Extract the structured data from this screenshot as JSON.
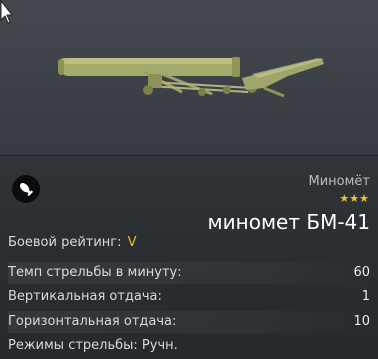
{
  "weapon": {
    "category": "Миномёт",
    "stars": "★★★",
    "name": "миномет БМ-41",
    "icon": "mortar-shell-icon"
  },
  "battle_rating": {
    "label": "Боевой рейтинг:",
    "value": "V"
  },
  "stats": [
    {
      "label": "Темп стрельбы в минуту:",
      "value": "60"
    },
    {
      "label": "Вертикальная отдача:",
      "value": "1"
    },
    {
      "label": "Горизонтальная отдача:",
      "value": "10"
    },
    {
      "label": "Режимы стрельбы: Ручн.",
      "value": ""
    }
  ],
  "colors": {
    "accent_yellow": "#f0c419",
    "stars": "#e6c33a",
    "barrel": "#a3a86a"
  }
}
